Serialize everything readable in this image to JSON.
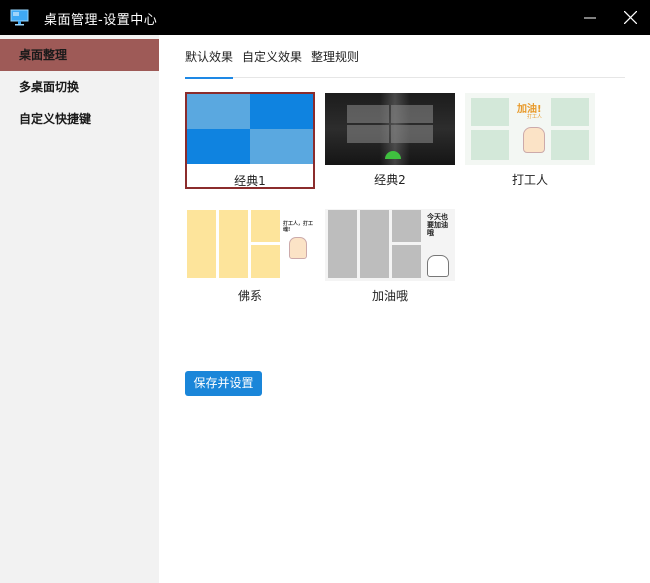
{
  "window": {
    "title": "桌面管理-设置中心"
  },
  "sidebar": {
    "items": [
      {
        "label": "桌面整理",
        "active": true
      },
      {
        "label": "多桌面切换",
        "active": false
      },
      {
        "label": "自定义快捷键",
        "active": false
      }
    ]
  },
  "tabs": [
    {
      "label": "默认效果",
      "active": true
    },
    {
      "label": "自定义效果",
      "active": false
    },
    {
      "label": "整理规则",
      "active": false
    }
  ],
  "themes": [
    {
      "label": "经典1",
      "selected": true
    },
    {
      "label": "经典2",
      "selected": false
    },
    {
      "label": "打工人",
      "selected": false,
      "banner": "加油!",
      "banner_sub": "打工人"
    },
    {
      "label": "佛系",
      "selected": false,
      "banner": "打工人，打工魂!"
    },
    {
      "label": "加油哦",
      "selected": false,
      "banner": "今天也要加油哦"
    }
  ],
  "actions": {
    "save_label": "保存并设置"
  },
  "colors": {
    "titlebar": "#000000",
    "sidebar_bg": "#f2f2f2",
    "sidebar_active": "#9e5a57",
    "accent": "#1e88e5",
    "selected_border": "#8b2c2c",
    "button": "#1a86d9"
  },
  "icons": [
    "monitor-app-icon",
    "minimize-icon",
    "close-icon"
  ]
}
